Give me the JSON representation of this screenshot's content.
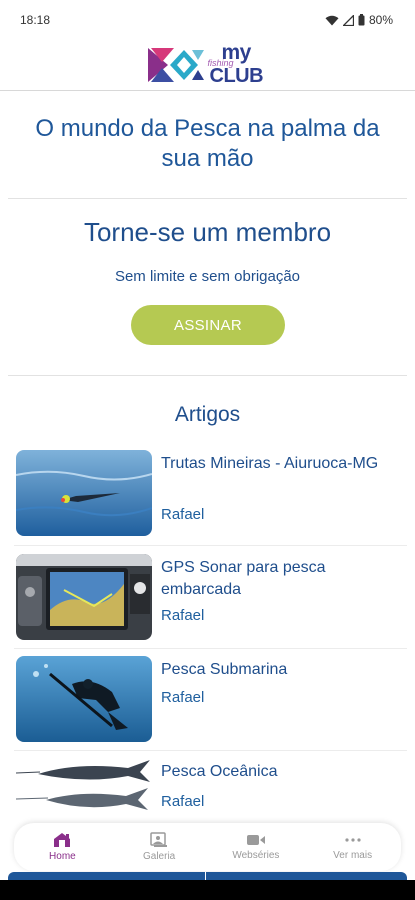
{
  "status": {
    "time": "18:18",
    "battery": "80%"
  },
  "brand": {
    "my": "my",
    "fishing": "fishing",
    "club": "CLUB"
  },
  "tagline": "O mundo da Pesca na palma da sua mão",
  "membership": {
    "title": "Torne-se um membro",
    "subtitle": "Sem limite e sem obrigação",
    "button": "ASSINAR"
  },
  "articles_section": {
    "title": "Artigos",
    "items": [
      {
        "title": "Trutas Mineiras -  Aiuruoca-MG",
        "author": "Rafael"
      },
      {
        "title": "GPS Sonar para pesca embarcada",
        "author": "Rafael"
      },
      {
        "title": "Pesca Submarina",
        "author": "Rafael"
      },
      {
        "title": "Pesca Oceânica",
        "author": "Rafael"
      }
    ]
  },
  "bottom_nav": [
    {
      "label": "Home",
      "icon": "home-icon",
      "active": true
    },
    {
      "label": "Galeria",
      "icon": "gallery-icon",
      "active": false
    },
    {
      "label": "Webséries",
      "icon": "video-camera-icon",
      "active": false
    },
    {
      "label": "Ver mais",
      "icon": "more-dots-icon",
      "active": false
    }
  ],
  "colors": {
    "accent": "#1f5799",
    "button": "#b5c952",
    "active_nav": "#8a2f8a"
  }
}
